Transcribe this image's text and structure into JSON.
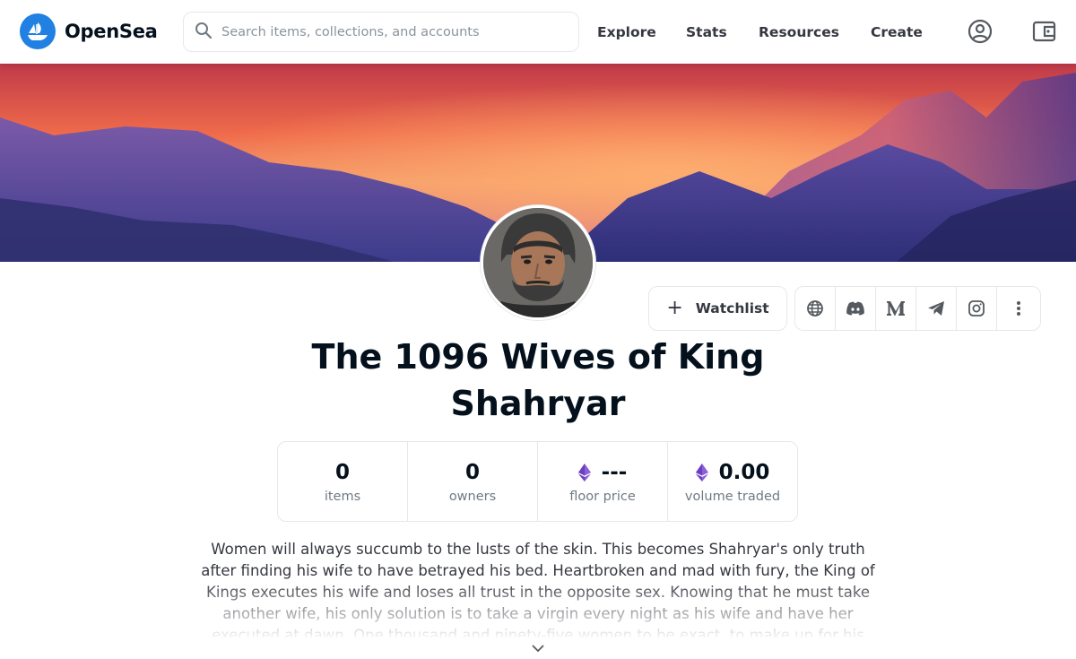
{
  "header": {
    "brand": "OpenSea",
    "search_placeholder": "Search items, collections, and accounts",
    "nav": {
      "explore": "Explore",
      "stats": "Stats",
      "resources": "Resources",
      "create": "Create"
    },
    "icons": [
      "opensea-logo-icon",
      "search-icon",
      "profile-icon",
      "wallet-icon"
    ],
    "brand_color": "#2081e2"
  },
  "collection": {
    "title": "The 1096 Wives of King Shahryar",
    "watchlist_label": "Watchlist",
    "social_icons": [
      "globe-icon",
      "discord-icon",
      "medium-icon",
      "telegram-icon",
      "instagram-icon",
      "more-icon"
    ],
    "stats": [
      {
        "value": "0",
        "label": "items"
      },
      {
        "value": "0",
        "label": "owners"
      },
      {
        "value": "---",
        "label": "floor price",
        "currency_icon": "eth-icon"
      },
      {
        "value": "0.00",
        "label": "volume traded",
        "currency_icon": "eth-icon"
      }
    ],
    "description": "Women will always succumb to the lusts of the skin. This becomes Shahryar's only truth after finding his wife to have betrayed his bed. Heartbroken and mad with fury, the King of Kings executes his wife and loses all trust in the opposite sex. Knowing that he must take another wife, his only solution is to take a virgin every night as his wife and have her executed at dawn. One thousand and ninety-five women to be exact, to make up for his wife's one treacherous"
  }
}
